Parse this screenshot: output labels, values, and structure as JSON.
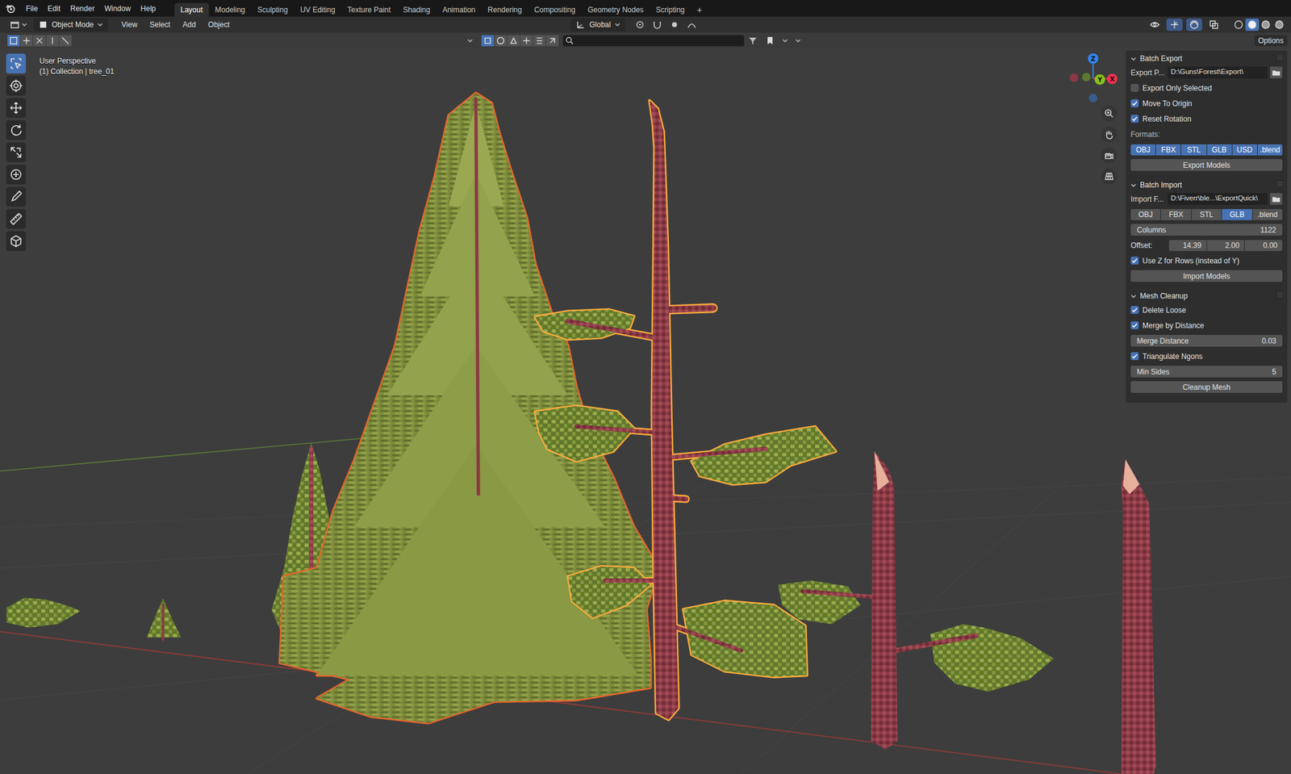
{
  "menus": [
    "File",
    "Edit",
    "Render",
    "Window",
    "Help"
  ],
  "workspaces": [
    {
      "label": "Layout",
      "selected": true
    },
    {
      "label": "Modeling",
      "selected": false
    },
    {
      "label": "Sculpting",
      "selected": false
    },
    {
      "label": "UV Editing",
      "selected": false
    },
    {
      "label": "Texture Paint",
      "selected": false
    },
    {
      "label": "Shading",
      "selected": false
    },
    {
      "label": "Animation",
      "selected": false
    },
    {
      "label": "Rendering",
      "selected": false
    },
    {
      "label": "Compositing",
      "selected": false
    },
    {
      "label": "Geometry Nodes",
      "selected": false
    },
    {
      "label": "Scripting",
      "selected": false
    }
  ],
  "add_workspace": "+",
  "header": {
    "mode": "Object Mode",
    "menus": [
      "View",
      "Select",
      "Add",
      "Object"
    ],
    "orientation": "Global",
    "viewport_toggles": [
      {
        "on": false
      },
      {
        "on": true
      },
      {
        "on": true
      },
      {
        "on": false
      }
    ],
    "shading": [
      {
        "selected": false
      },
      {
        "selected": true
      },
      {
        "selected": false
      },
      {
        "selected": false
      }
    ]
  },
  "tool_header": {
    "select_modes": [
      {
        "selected": true
      },
      {
        "selected": false
      },
      {
        "selected": false
      },
      {
        "selected": false
      },
      {
        "selected": false
      }
    ],
    "filters": [
      {
        "selected": true
      },
      {
        "selected": false
      },
      {
        "selected": false
      },
      {
        "selected": false
      },
      {
        "selected": false
      },
      {
        "selected": false
      }
    ],
    "options": "Options"
  },
  "toolbar": [
    {
      "selected": true
    },
    {
      "selected": false
    },
    {
      "selected": false
    },
    {
      "selected": false
    },
    {
      "selected": false
    },
    {
      "selected": false
    },
    {
      "selected": false
    },
    {
      "selected": false
    },
    {
      "selected": false
    }
  ],
  "viewport": {
    "view": "User Perspective",
    "context": "(1) Collection | tree_01"
  },
  "gizmo": [
    {
      "axis": "Z",
      "color": "#2f86ee"
    },
    {
      "axis": "Y",
      "color": "#86c41c"
    },
    {
      "axis": "X",
      "color": "#ec3350"
    }
  ],
  "scene": [
    {
      "selected": false,
      "active": false
    },
    {
      "selected": false,
      "active": false
    },
    {
      "selected": false,
      "active": false
    },
    {
      "selected": false,
      "active": false
    },
    {
      "selected": false,
      "active": false
    },
    {
      "selected": true,
      "active": false
    },
    {
      "selected": true,
      "active": true
    }
  ],
  "sidebar": {
    "panels": [
      {
        "title": "Batch Export",
        "expanded": true,
        "rows": [
          {
            "kind": "path",
            "label": "Export P...",
            "value": "D:\\Guns\\Forest\\Export\\"
          },
          {
            "kind": "checkbox",
            "label": "Export Only Selected",
            "checked": false
          },
          {
            "kind": "checkbox",
            "label": "Move To Origin",
            "checked": true
          },
          {
            "kind": "checkbox",
            "label": "Reset Rotation",
            "checked": true
          },
          {
            "kind": "label",
            "label": "Formats:"
          },
          {
            "kind": "toggles",
            "items": [
              {
                "label": "OBJ",
                "selected": true
              },
              {
                "label": "FBX",
                "selected": true
              },
              {
                "label": "STL",
                "selected": true
              },
              {
                "label": "GLB",
                "selected": true
              },
              {
                "label": "USD",
                "selected": true
              },
              {
                "label": ".blend",
                "selected": true
              }
            ]
          },
          {
            "kind": "button",
            "label": "Export Models"
          }
        ]
      },
      {
        "title": "Batch Import",
        "expanded": true,
        "rows": [
          {
            "kind": "path",
            "label": "Import F...",
            "value": "D:\\Fiverr\\ble...\\ExportQuick\\"
          },
          {
            "kind": "toggles",
            "items": [
              {
                "label": "OBJ",
                "selected": false
              },
              {
                "label": "FBX",
                "selected": false
              },
              {
                "label": "STL",
                "selected": false
              },
              {
                "label": "GLB",
                "selected": true
              },
              {
                "label": ".blend",
                "selected": false
              }
            ]
          },
          {
            "kind": "number",
            "label": "Columns",
            "value": "1122"
          },
          {
            "kind": "vector",
            "label": "Offset:",
            "values": [
              "14.39",
              "2.00",
              "0.00"
            ]
          },
          {
            "kind": "checkbox",
            "label": "Use Z for Rows (instead of Y)",
            "checked": true
          },
          {
            "kind": "button",
            "label": "Import Models"
          }
        ]
      },
      {
        "title": "Mesh Cleanup",
        "expanded": true,
        "rows": [
          {
            "kind": "checkbox",
            "label": "Delete Loose",
            "checked": true
          },
          {
            "kind": "checkbox",
            "label": "Merge by Distance",
            "checked": true
          },
          {
            "kind": "number",
            "label": "Merge Distance",
            "value": "0.03"
          },
          {
            "kind": "checkbox",
            "label": "Triangulate Ngons",
            "checked": true
          },
          {
            "kind": "number",
            "label": "Min Sides",
            "value": "5"
          },
          {
            "kind": "button",
            "label": "Cleanup Mesh"
          }
        ]
      }
    ]
  }
}
